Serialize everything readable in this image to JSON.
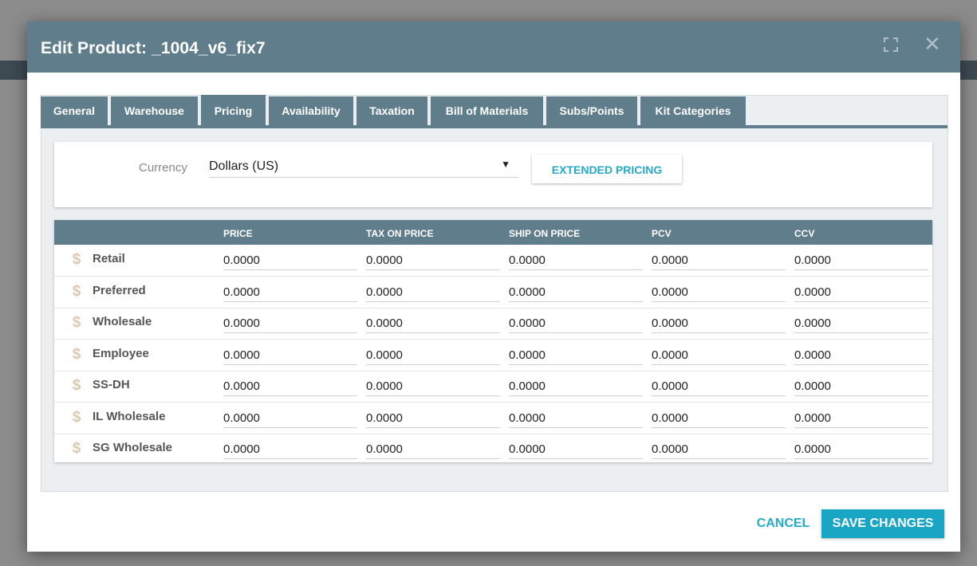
{
  "modal": {
    "title": "Edit Product: _1004_v6_fix7",
    "expand_icon": "expand-icon",
    "close_icon": "close-icon",
    "close_glyph": "✕"
  },
  "tabs": [
    {
      "label": "General",
      "active": false
    },
    {
      "label": "Warehouse",
      "active": false
    },
    {
      "label": "Pricing",
      "active": true
    },
    {
      "label": "Availability",
      "active": false
    },
    {
      "label": "Taxation",
      "active": false
    },
    {
      "label": "Bill of Materials",
      "active": false
    },
    {
      "label": "Subs/Points",
      "active": false
    },
    {
      "label": "Kit Categories",
      "active": false
    }
  ],
  "currency": {
    "label": "Currency",
    "value": "Dollars (US)",
    "caret": "▼"
  },
  "extended_pricing_label": "EXTENDED PRICING",
  "table": {
    "headers": [
      "PRICE",
      "TAX ON PRICE",
      "SHIP ON PRICE",
      "PCV",
      "CCV"
    ],
    "row_icon": "dollar-icon",
    "row_icon_glyph": "$",
    "rows": [
      {
        "label": "Retail",
        "values": [
          "0.0000",
          "0.0000",
          "0.0000",
          "0.0000",
          "0.0000"
        ]
      },
      {
        "label": "Preferred",
        "values": [
          "0.0000",
          "0.0000",
          "0.0000",
          "0.0000",
          "0.0000"
        ]
      },
      {
        "label": "Wholesale",
        "values": [
          "0.0000",
          "0.0000",
          "0.0000",
          "0.0000",
          "0.0000"
        ]
      },
      {
        "label": "Employee",
        "values": [
          "0.0000",
          "0.0000",
          "0.0000",
          "0.0000",
          "0.0000"
        ]
      },
      {
        "label": "SS-DH",
        "values": [
          "0.0000",
          "0.0000",
          "0.0000",
          "0.0000",
          "0.0000"
        ]
      },
      {
        "label": "IL Wholesale",
        "values": [
          "0.0000",
          "0.0000",
          "0.0000",
          "0.0000",
          "0.0000"
        ]
      },
      {
        "label": "SG Wholesale",
        "values": [
          "0.0000",
          "0.0000",
          "0.0000",
          "0.0000",
          "0.0000"
        ]
      }
    ]
  },
  "footer": {
    "cancel_label": "CANCEL",
    "save_label": "SAVE CHANGES"
  },
  "colors": {
    "header_bg": "#607d8b",
    "accent": "#19a6c4",
    "panel_bg": "#eceff1"
  }
}
